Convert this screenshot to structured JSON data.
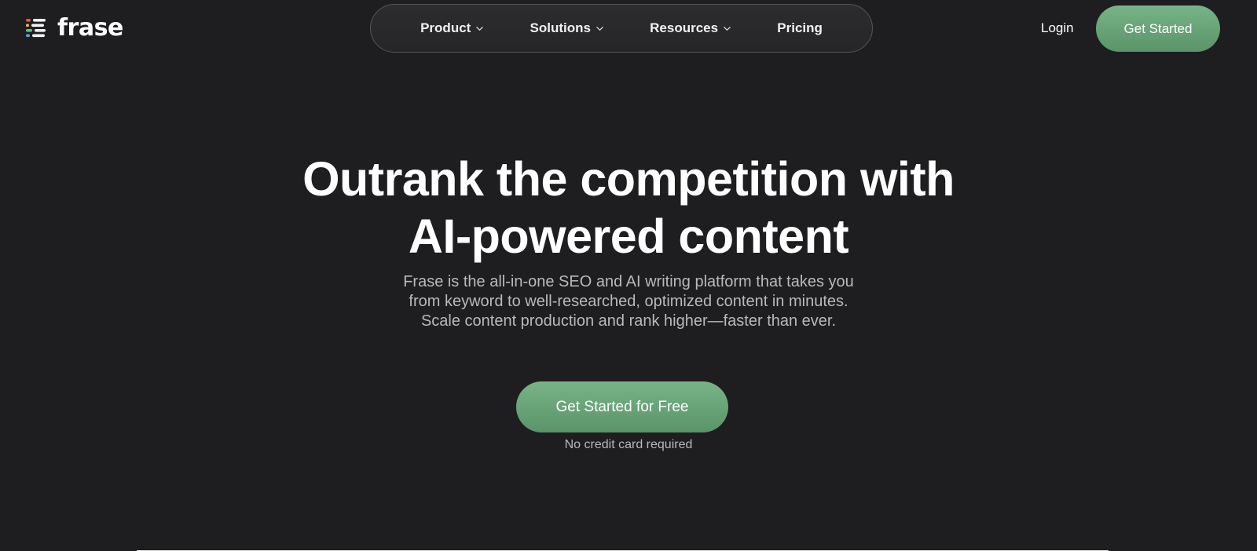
{
  "brand": {
    "name": "frase",
    "accent": "#6aa57a"
  },
  "nav": {
    "items": [
      {
        "label": "Product",
        "has_dropdown": true
      },
      {
        "label": "Solutions",
        "has_dropdown": true
      },
      {
        "label": "Resources",
        "has_dropdown": true
      },
      {
        "label": "Pricing",
        "has_dropdown": false
      }
    ],
    "login_label": "Login",
    "cta_label": "Get Started"
  },
  "hero": {
    "title_line1": "Outrank the competition with",
    "title_line2": "AI-powered content",
    "subtitle_line1": "Frase is the all-in-one SEO and AI writing platform that takes you",
    "subtitle_line2": "from keyword to well-researched, optimized content in minutes.",
    "subtitle_line3": "Scale content production and rank higher—faster than ever.",
    "cta_label": "Get Started for Free",
    "note": "No credit card required"
  },
  "icons": {
    "logo": "frase-logo-icon",
    "dropdown": "chevron-down-icon"
  }
}
